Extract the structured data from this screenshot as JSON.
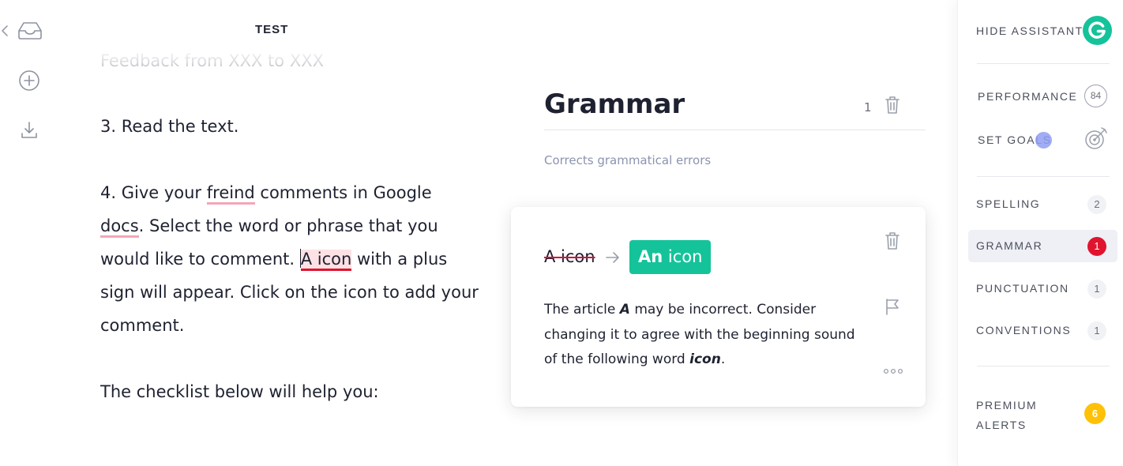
{
  "document": {
    "title": "TEST",
    "faded_line": "Feedback from XXX to XXX",
    "p3": "3. Read the text.",
    "p4": {
      "t1": "4. Give your ",
      "misspelled": "freind",
      "t2": " comments in Google ",
      "flagged": "docs",
      "t3": ". Select the word or phrase that you would like to comment. ",
      "grammar_error": "A icon",
      "t4": " with a plus sign will appear. Click on the icon to add your comment."
    },
    "p5": "The checklist below will help you:"
  },
  "panel": {
    "category_title": "Grammar",
    "category_count": "1",
    "category_desc": "Corrects grammatical errors",
    "card": {
      "original": "A icon",
      "replacement_bold": "An",
      "replacement_rest": " icon",
      "exp_1": "The article ",
      "exp_2": "A",
      "exp_3": " may be incorrect. Consider changing it to agree with the beginning sound of the following word ",
      "exp_4": "icon",
      "exp_5": "."
    }
  },
  "sidebar": {
    "hide_assistant": "HIDE ASSISTANT",
    "performance": "PERFORMANCE",
    "performance_score": "84",
    "set_goals": "SET GOALS",
    "categories": [
      {
        "label": "SPELLING",
        "count": "2"
      },
      {
        "label": "GRAMMAR",
        "count": "1"
      },
      {
        "label": "PUNCTUATION",
        "count": "1"
      },
      {
        "label": "CONVENTIONS",
        "count": "1"
      }
    ],
    "premium_line1": "PREMIUM",
    "premium_line2": "ALERTS",
    "premium_count": "6"
  },
  "colors": {
    "brand_green": "#15c39a",
    "error_red": "#e0142e",
    "premium_yellow": "#ffc107"
  },
  "icons": [
    "back-chevron-icon",
    "inbox-icon",
    "add-circle-icon",
    "download-icon",
    "trash-icon",
    "arrow-right-icon",
    "flag-icon",
    "more-icon",
    "grammarly-logo-icon",
    "target-icon"
  ]
}
